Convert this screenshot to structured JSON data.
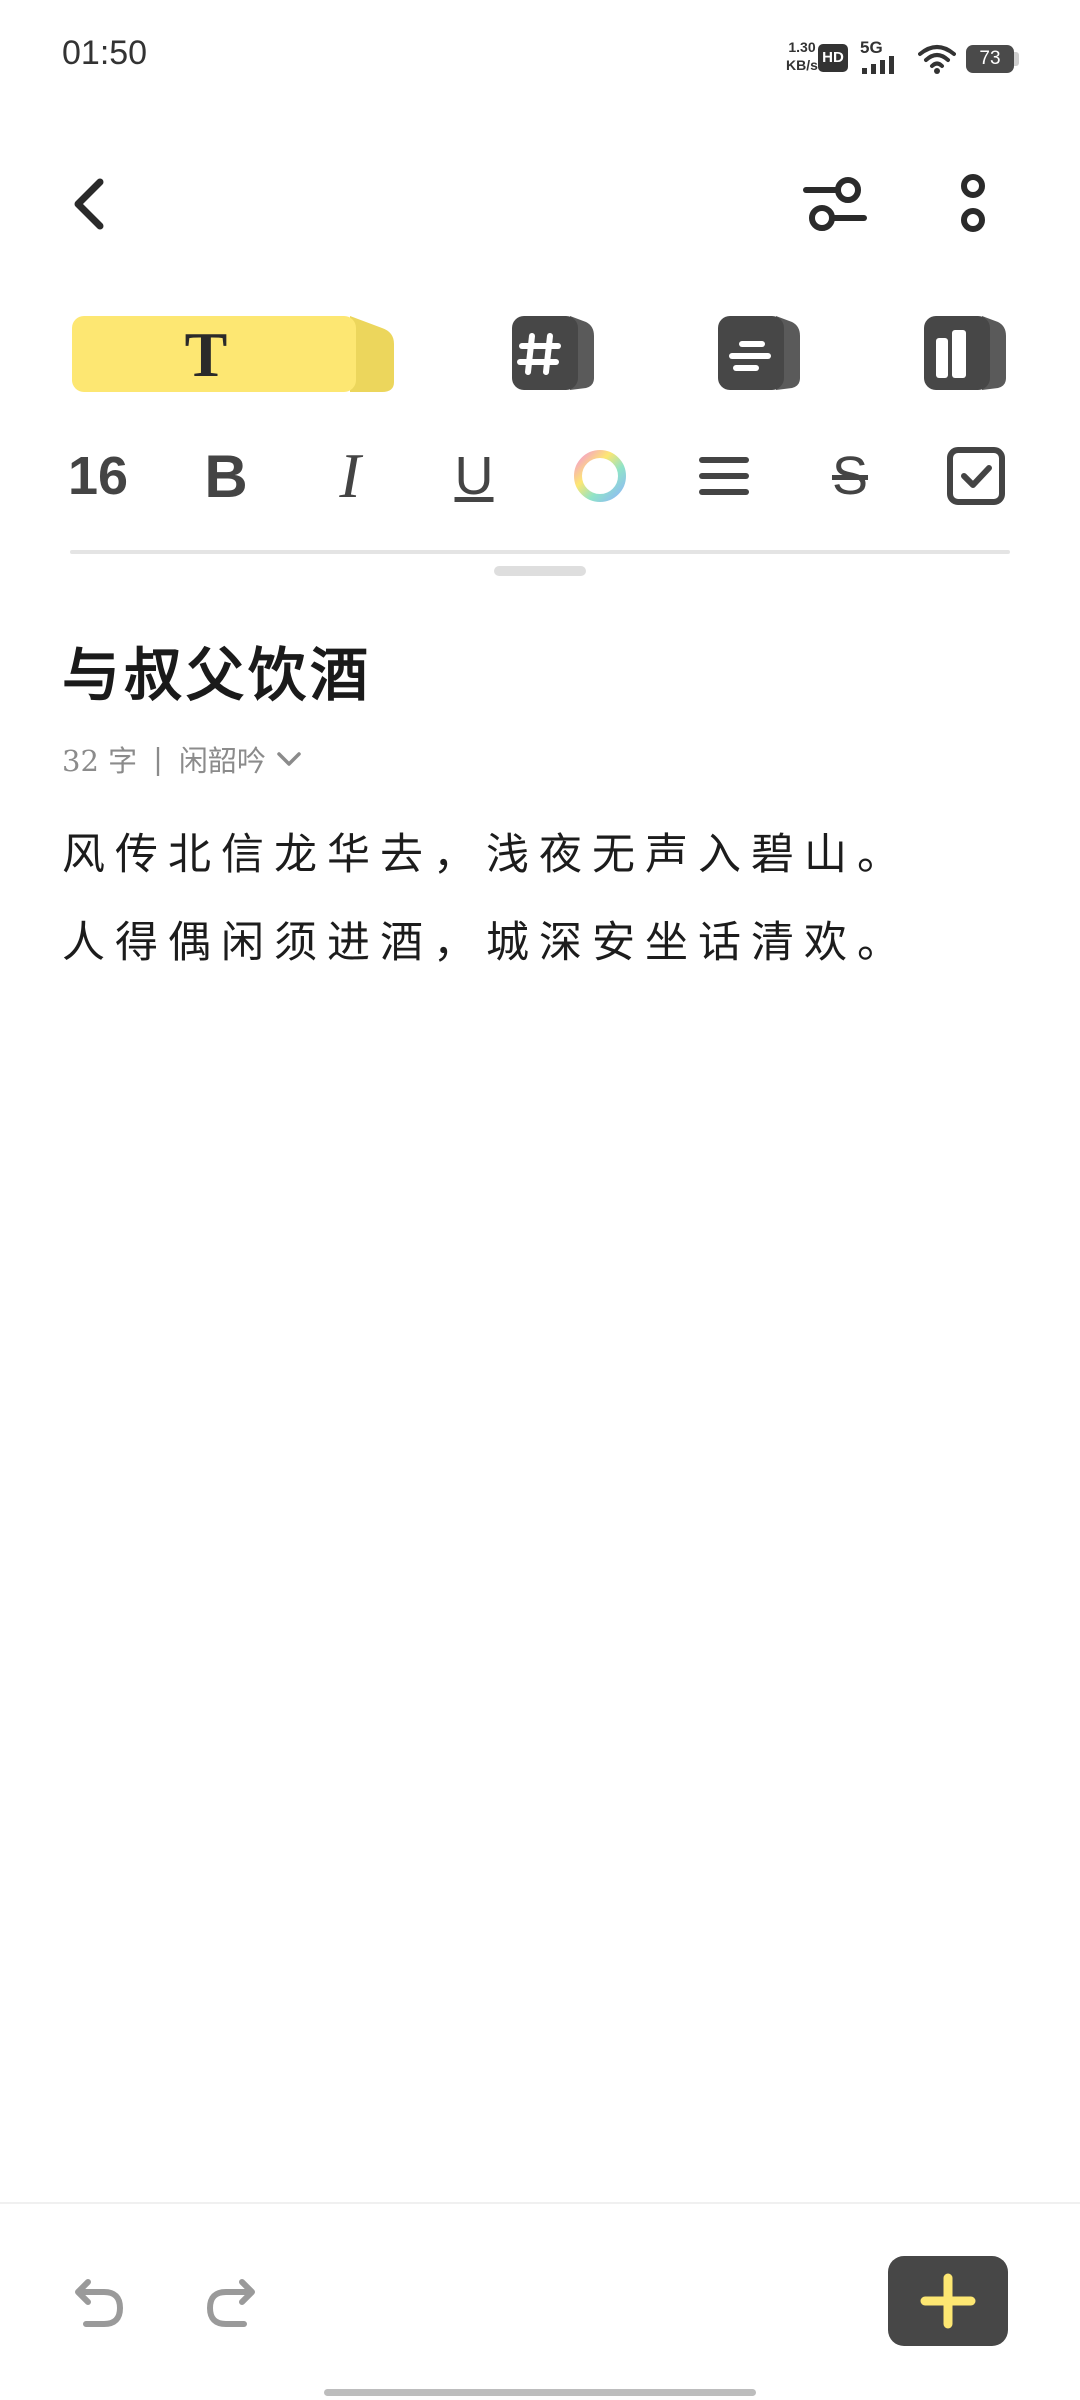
{
  "status_bar": {
    "time": "01:50",
    "net_speed_value": "1.30",
    "net_speed_unit": "KB/s",
    "hd_label": "HD",
    "signal_label": "5G",
    "battery_level": "73"
  },
  "header": {
    "back_icon": "chevron-left-icon",
    "filter_icon": "sliders-icon",
    "more_icon": "more-vertical-icon"
  },
  "tool_tabs": [
    {
      "name": "text-style",
      "icon": "T",
      "active": true,
      "accent": "#fde772"
    },
    {
      "name": "tag",
      "icon": "hash-icon",
      "active": false
    },
    {
      "name": "list",
      "icon": "lines-icon",
      "active": false
    },
    {
      "name": "layout",
      "icon": "layout-icon",
      "active": false
    }
  ],
  "format_bar": {
    "font_size": "16",
    "bold": "B",
    "italic": "I",
    "underline": "U",
    "strikethrough": "S"
  },
  "note": {
    "title": "与叔父饮酒",
    "word_count": "32 字",
    "separator": "|",
    "notebook": "闲韶吟",
    "lines": [
      "风传北信龙华去，浅夜无声入碧山。",
      "人得偶闲须进酒，城深安坐话清欢。"
    ]
  },
  "colors": {
    "accent_yellow": "#fde772",
    "icon_dark": "#474747",
    "muted_text": "#8b8b8b"
  }
}
